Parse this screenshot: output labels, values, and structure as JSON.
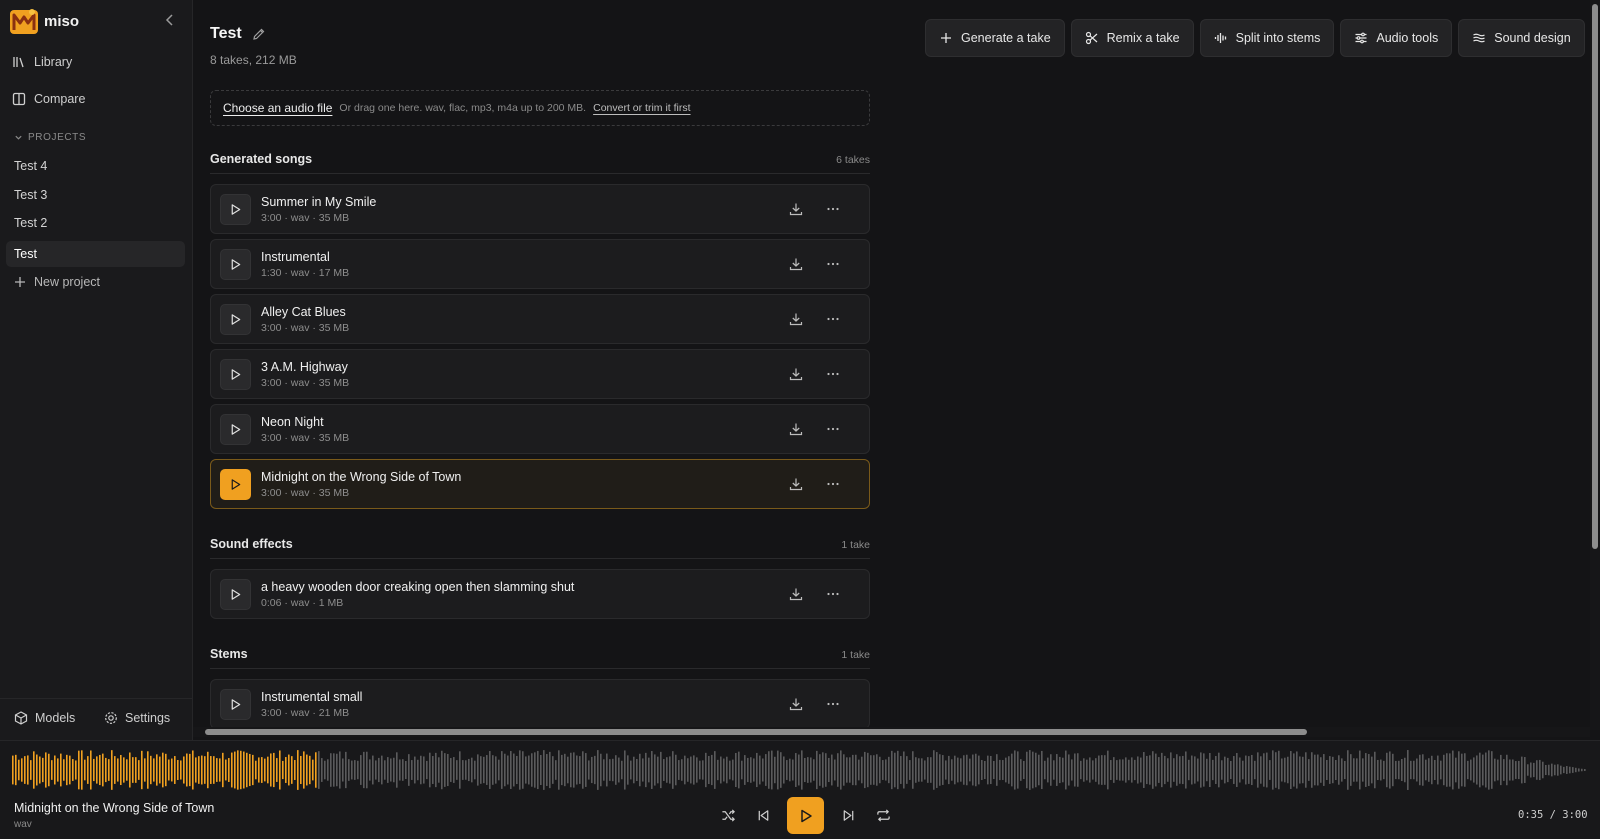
{
  "app": {
    "name": "miso"
  },
  "sidebar": {
    "nav": [
      {
        "label": "Library",
        "icon": "library-icon"
      },
      {
        "label": "Compare",
        "icon": "compare-icon"
      }
    ],
    "projects_label": "PROJECTS",
    "projects": [
      {
        "label": "Test 4",
        "active": false
      },
      {
        "label": "Test 3",
        "active": false
      },
      {
        "label": "Test 2",
        "active": false
      },
      {
        "label": "Test",
        "active": true
      }
    ],
    "new_project": "New project",
    "footer": {
      "models": "Models",
      "settings": "Settings"
    }
  },
  "project": {
    "title": "Test",
    "summary": "8 takes, 212 MB"
  },
  "toolbar": {
    "generate": "Generate a take",
    "remix": "Remix a take",
    "split": "Split into stems",
    "audio_tools": "Audio tools",
    "sound_design": "Sound design"
  },
  "dropzone": {
    "choose": "Choose an audio file",
    "hint": "Or drag one here. wav, flac, mp3, m4a up to 200 MB.",
    "convert": "Convert or trim it first"
  },
  "sections": {
    "songs": {
      "name": "Generated songs",
      "count": "6 takes"
    },
    "sfx": {
      "name": "Sound effects",
      "count": "1 take"
    },
    "stems": {
      "name": "Stems",
      "count": "1 take"
    }
  },
  "tracks": [
    {
      "title": "Summer in My Smile",
      "meta": "3:00 · wav · 35 MB"
    },
    {
      "title": "Instrumental",
      "meta": "1:30 · wav · 17 MB"
    },
    {
      "title": "Alley Cat Blues",
      "meta": "3:00 · wav · 35 MB"
    },
    {
      "title": "3 A.M. Highway",
      "meta": "3:00 · wav · 35 MB"
    },
    {
      "title": "Neon Night",
      "meta": "3:00 · wav · 35 MB"
    },
    {
      "title": "Midnight on the Wrong Side of Town",
      "meta": "3:00 · wav · 35 MB"
    },
    {
      "title": "a heavy wooden door creaking open then slamming shut",
      "meta": "0:06 · wav · 1 MB"
    },
    {
      "title": "Instrumental small",
      "meta": "3:00 · wav · 21 MB"
    }
  ],
  "player": {
    "title": "Midnight on the Wrong Side of Town",
    "format": "wav",
    "time": "0:35 / 3:00",
    "progress": 0.194,
    "played_color": "#f0a020",
    "unplayed_color": "#5a5a5c"
  },
  "colors": {
    "accent": "#f0a020",
    "background": "#141416"
  }
}
